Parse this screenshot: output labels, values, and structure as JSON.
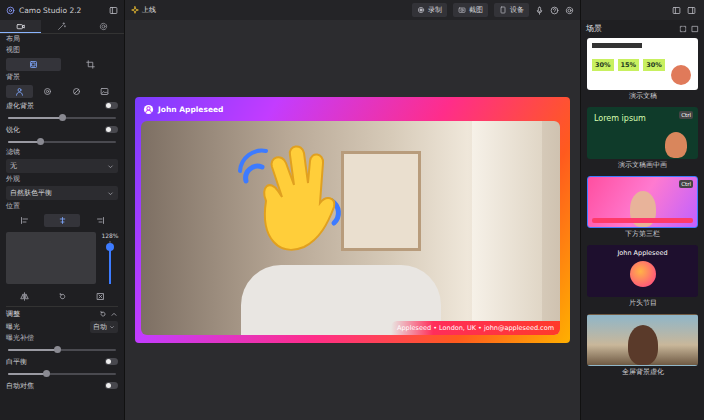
{
  "app": {
    "title": "Camo Studio 2.2"
  },
  "left_tabs": [
    {
      "selected": true
    },
    {
      "selected": false
    },
    {
      "selected": false
    }
  ],
  "settings": [
    {
      "kind": "label",
      "text": "布局"
    },
    {
      "kind": "label",
      "text": "视图"
    },
    {
      "kind": "icons",
      "items": [
        {
          "selected": true
        },
        {
          "selected": false
        }
      ]
    },
    {
      "kind": "label",
      "text": "背景"
    },
    {
      "kind": "icons",
      "items": [
        {
          "selected": true
        },
        {
          "selected": false
        },
        {
          "selected": false
        },
        {
          "selected": false
        }
      ]
    },
    {
      "kind": "toggle",
      "text": "虚化背景",
      "on": false
    },
    {
      "kind": "slider",
      "level": 0.5
    },
    {
      "kind": "toggle",
      "text": "锐化",
      "on": false
    },
    {
      "kind": "slider",
      "level": 0.3
    },
    {
      "kind": "label",
      "text": "滤镜"
    },
    {
      "kind": "select",
      "value": "无"
    },
    {
      "kind": "label",
      "text": "外观"
    },
    {
      "kind": "select",
      "value": "自然肤色平衡"
    },
    {
      "kind": "label",
      "text": "位置"
    },
    {
      "kind": "icons",
      "items": [
        {
          "selected": false
        },
        {
          "selected": true
        },
        {
          "selected": false
        }
      ]
    },
    {
      "kind": "zoom",
      "reading": "128%",
      "level": 0.85
    },
    {
      "kind": "icons",
      "items": [
        {
          "selected": false
        },
        {
          "selected": false
        },
        {
          "selected": false
        }
      ]
    },
    {
      "kind": "header",
      "text": "调整"
    },
    {
      "kind": "select_row",
      "text": "曝光",
      "value": "自动"
    },
    {
      "kind": "label",
      "text": "曝光补偿"
    },
    {
      "kind": "slider",
      "level": 0.45
    },
    {
      "kind": "toggle",
      "text": "白平衡",
      "on": false
    },
    {
      "kind": "slider",
      "level": 0.35
    },
    {
      "kind": "toggle",
      "text": "自动对焦",
      "on": false
    }
  ],
  "topbar": {
    "status": "上线",
    "buttons": [
      {
        "label": "录制"
      },
      {
        "label": "截图"
      },
      {
        "label": "设备"
      }
    ]
  },
  "video": {
    "name": "John Appleseed",
    "caption": "Appleseed • London, UK • john@appleseed.com"
  },
  "scenes": {
    "title": "场景",
    "items": [
      {
        "label": "演示文稿",
        "selected": false,
        "kind": "stats",
        "stats": [
          "30%",
          "15%",
          "30%"
        ]
      },
      {
        "label": "演示文稿画中画",
        "selected": false,
        "kind": "lorem",
        "title": "Lorem ipsum",
        "badge": "Ctrl"
      },
      {
        "label": "下方第三栏",
        "selected": true,
        "kind": "lower",
        "badge": "Ctrl"
      },
      {
        "label": "片头节目",
        "selected": false,
        "kind": "title",
        "title": "John Appleseed"
      },
      {
        "label": "全屏背景虚化",
        "selected": false,
        "kind": "photo"
      }
    ]
  }
}
